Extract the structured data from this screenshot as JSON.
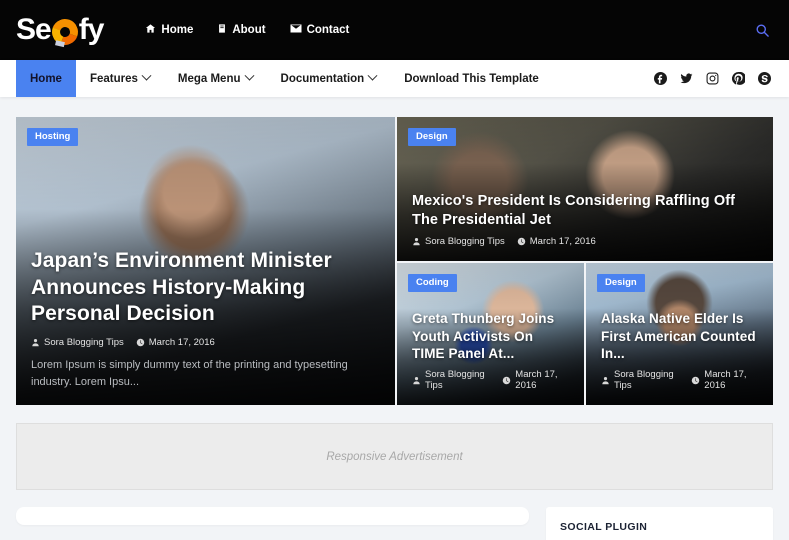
{
  "site": {
    "logo_text_1": "Se",
    "logo_text_2": "fy",
    "logo_icon": "orange-ring-icon"
  },
  "topbar": {
    "links": [
      {
        "label": "Home",
        "icon": "house-icon"
      },
      {
        "label": "About",
        "icon": "book-icon"
      },
      {
        "label": "Contact",
        "icon": "envelope-icon"
      }
    ],
    "search_icon": "search-icon"
  },
  "mainnav": {
    "items": [
      {
        "label": "Home",
        "has_caret": false,
        "active": true
      },
      {
        "label": "Features",
        "has_caret": true,
        "active": false
      },
      {
        "label": "Mega Menu",
        "has_caret": true,
        "active": false
      },
      {
        "label": "Documentation",
        "has_caret": true,
        "active": false
      },
      {
        "label": "Download This Template",
        "has_caret": false,
        "active": false
      }
    ],
    "social": [
      {
        "name": "facebook-icon"
      },
      {
        "name": "twitter-icon"
      },
      {
        "name": "instagram-icon"
      },
      {
        "name": "pinterest-icon"
      },
      {
        "name": "skype-icon"
      }
    ]
  },
  "featured": {
    "main": {
      "badge": "Hosting",
      "title": "Japan’s Environment Minister Announces History-Making Personal Decision",
      "author": "Sora Blogging Tips",
      "date": "March 17, 2016",
      "snippet": "Lorem Ipsum is simply dummy text of the printing and typesetting industry. Lorem Ipsu..."
    },
    "top_right": {
      "badge": "Design",
      "title": "Mexico's President Is Considering Raffling Off The Presidential Jet",
      "author": "Sora Blogging Tips",
      "date": "March 17, 2016"
    },
    "bottom_left": {
      "badge": "Coding",
      "title": "Greta Thunberg Joins Youth Activists On TIME Panel At...",
      "author": "Sora Blogging Tips",
      "date": "March 17, 2016"
    },
    "bottom_right": {
      "badge": "Design",
      "title": "Alaska Native Elder Is First American Counted In...",
      "author": "Sora Blogging Tips",
      "date": "March 17, 2016"
    }
  },
  "advertisement": {
    "label": "Responsive Advertisement"
  },
  "sidebar": {
    "social_plugin_title": "SOCIAL PLUGIN"
  },
  "colors": {
    "accent_blue": "#4a82f0",
    "header_black": "#050505",
    "page_bg": "#f2f4f7",
    "logo_orange": "#f59000",
    "search_blue": "#5b6ef5"
  }
}
